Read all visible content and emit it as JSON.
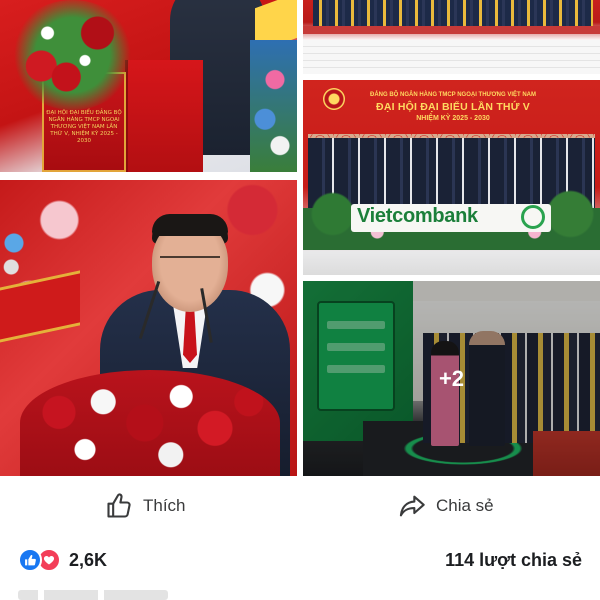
{
  "photos": [
    {
      "name": "speaker-podium-photo",
      "podium_text": "ĐẠI HỘI ĐẠI BIỂU ĐẢNG BỘ NGÂN HÀNG TMCP NGOẠI THƯƠNG VIỆT NAM LẦN THỨ V, NHIỆM KỲ 2025 - 2030"
    },
    {
      "name": "stage-group-photo"
    },
    {
      "name": "delegation-photo",
      "backdrop_small": "ĐẢNG BỘ NGÂN HÀNG TMCP NGOẠI THƯƠNG VIỆT NAM",
      "backdrop_title": "ĐẠI HỘI ĐẠI BIỂU LẦN THỨ V",
      "backdrop_term": "NHIỆM KỲ 2025 - 2030",
      "sign_text": "Vietcombank"
    },
    {
      "name": "speaker-closeup-photo"
    },
    {
      "name": "exhibition-photo",
      "more_count": "+2"
    }
  ],
  "actions": {
    "like_label": "Thích",
    "share_label": "Chia sẻ"
  },
  "stats": {
    "reaction_count": "2,6K",
    "share_count": "114 lượt chia sẻ",
    "reactions": [
      "like-icon",
      "love-icon"
    ]
  },
  "colors": {
    "like_blue": "#1877f2",
    "love_red": "#f33e58",
    "brand_green": "#1b7f3a"
  }
}
